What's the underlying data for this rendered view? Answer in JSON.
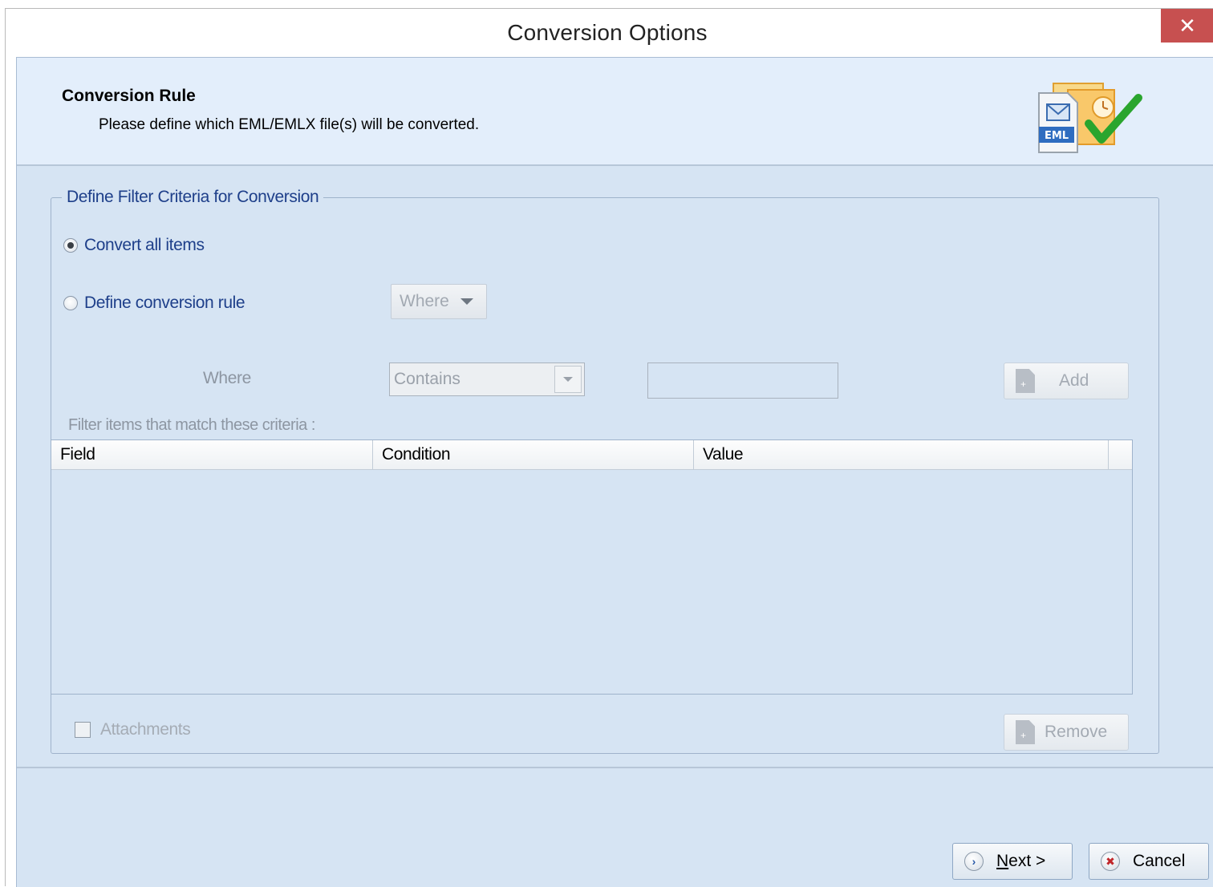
{
  "window": {
    "title": "Conversion Options",
    "close_glyph": "✕"
  },
  "header": {
    "title": "Conversion Rule",
    "subtitle": "Please define which EML/EMLX file(s) will be converted.",
    "icon_badge": "EML"
  },
  "filter_group": {
    "legend": "Define Filter Criteria for Conversion",
    "option_all": "Convert all items",
    "option_rule": "Define conversion rule",
    "selected": "option_all",
    "where_dropdown": "Where",
    "where_label": "Where",
    "condition_value": "Contains",
    "value_input": "",
    "add_label": "Add",
    "criteria_caption": "Filter items that match these criteria :",
    "columns": [
      "Field",
      "Condition",
      "Value"
    ],
    "rows": [],
    "attachments_label": "Attachments",
    "attachments_checked": false,
    "remove_label": "Remove"
  },
  "footer": {
    "next_mnemonic": "N",
    "next_rest": "ext >",
    "cancel_label": "Cancel"
  },
  "colors": {
    "accent_text": "#1e3f8a",
    "close_button": "#c75050",
    "frame_background": "#d6e4f3"
  }
}
